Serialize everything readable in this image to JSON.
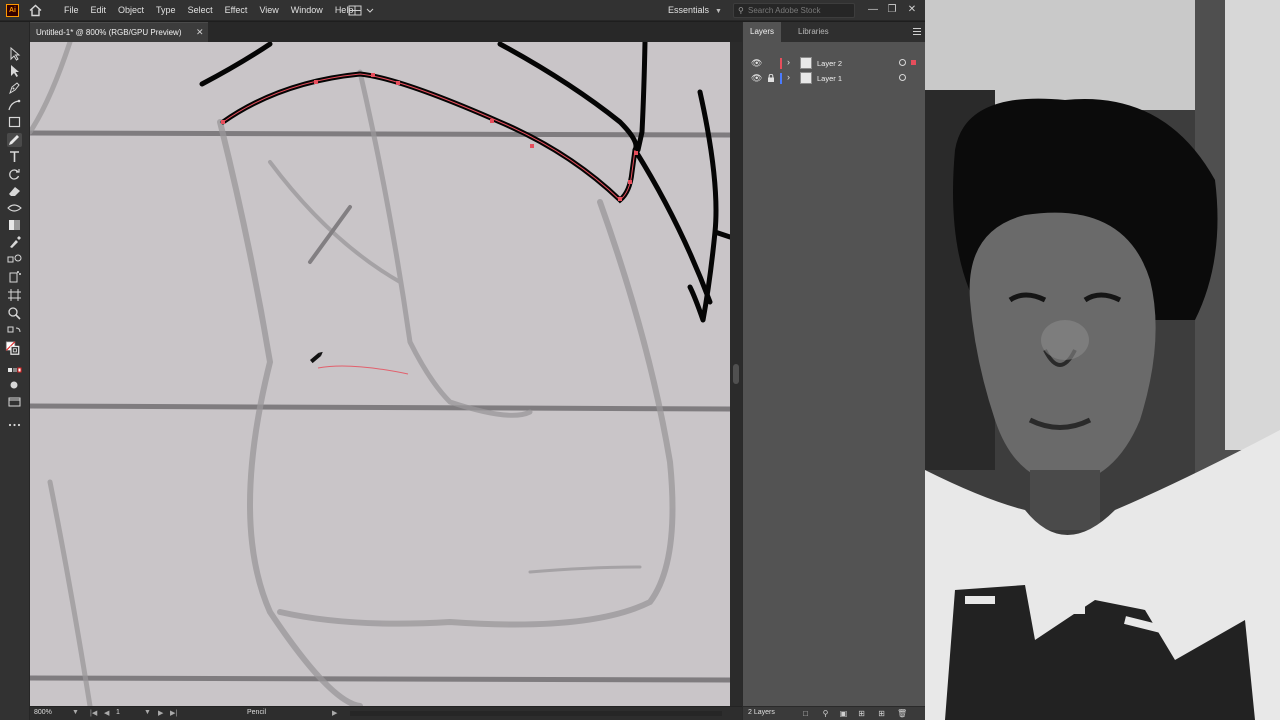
{
  "app": {
    "logo_text": "Ai",
    "brand_color": "#ff9a00"
  },
  "menu": {
    "items": [
      "File",
      "Edit",
      "Object",
      "Type",
      "Select",
      "Effect",
      "View",
      "Window",
      "Help"
    ]
  },
  "workspace": {
    "label": "Essentials"
  },
  "search": {
    "placeholder": "Search Adobe Stock"
  },
  "document": {
    "tab_title": "Untitled-1* @ 800% (RGB/GPU Preview)"
  },
  "tools": [
    "selection-tool-icon",
    "direct-selection-tool-icon",
    "pen-tool-icon",
    "curvature-tool-icon",
    "rectangle-tool-icon",
    "pencil-tool-icon",
    "type-tool-icon",
    "rotate-tool-icon",
    "eraser-tool-icon",
    "width-tool-icon",
    "gradient-tool-icon",
    "eyedropper-tool-icon",
    "blend-tool-icon",
    "symbol-sprayer-tool-icon",
    "artboard-tool-icon",
    "zoom-tool-icon"
  ],
  "layers_panel": {
    "tabs": [
      "Layers",
      "Libraries"
    ],
    "layers": [
      {
        "name": "Layer 2",
        "color": "#e64e5c",
        "selected": true,
        "locked": false
      },
      {
        "name": "Layer 1",
        "color": "#4a7bff",
        "selected": false,
        "locked": true
      }
    ],
    "count_label": "2 Layers"
  },
  "status": {
    "zoom": "800%",
    "artboard": "1",
    "tool": "Pencil"
  },
  "colors": {
    "path_highlight": "#e64e5c",
    "canvas": "#c9c5c8",
    "panel_bg": "#535353"
  }
}
